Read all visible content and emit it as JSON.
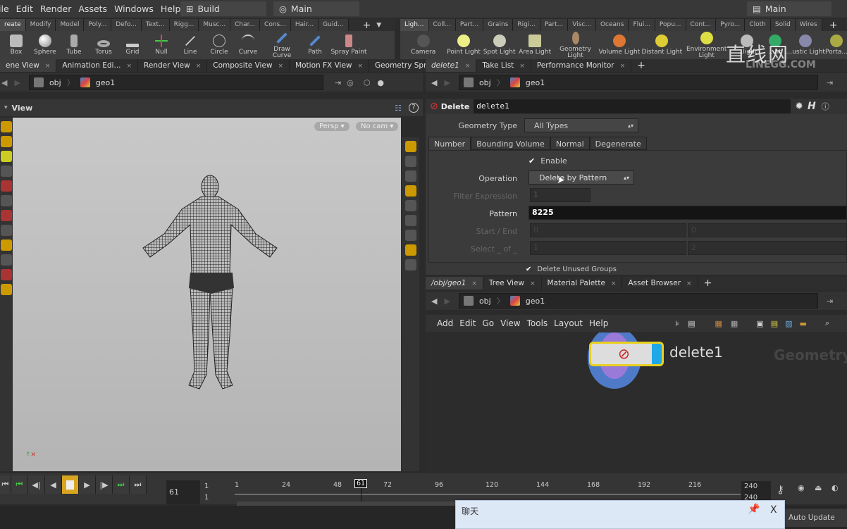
{
  "menubar": {
    "items": [
      "ile",
      "Edit",
      "Render",
      "Assets",
      "Windows",
      "Help"
    ],
    "desktop": "Build",
    "context_left": "Main",
    "context_right": "Main"
  },
  "shelf_left": {
    "tabs": [
      "reate",
      "Modify",
      "Model",
      "Poly...",
      "Defo...",
      "Text...",
      "Rigg...",
      "Musc...",
      "Char...",
      "Cons...",
      "Hair...",
      "Guid..."
    ],
    "tools": [
      "Box",
      "Sphere",
      "Tube",
      "Torus",
      "Grid",
      "Null",
      "Line",
      "Circle",
      "Curve",
      "Draw Curve",
      "Path",
      "Spray Paint"
    ]
  },
  "shelf_right": {
    "tabs": [
      "Ligh...",
      "Coll...",
      "Part...",
      "Grains",
      "Rigi...",
      "Part...",
      "Visc...",
      "Oceans",
      "Flui...",
      "Popu...",
      "Cont...",
      "Pyro...",
      "Cloth",
      "Solid",
      "Wires"
    ],
    "tools": [
      "Camera",
      "Point Light",
      "Spot Light",
      "Area Light",
      "Geometry Light",
      "Volume Light",
      "Distant Light",
      "Environment Light",
      "...light",
      "...ht",
      "...ustic Light",
      "Porta..."
    ]
  },
  "watermark": {
    "text": "直线网",
    "sub": "LINEGG.COM"
  },
  "left_pane": {
    "tabs": [
      "ene View",
      "Animation Edi...",
      "Render View",
      "Composite View",
      "Motion FX View",
      "Geometry Spr..."
    ],
    "path": [
      "obj",
      "geo1"
    ],
    "view_title": "View",
    "persp": "Persp",
    "cam": "No cam"
  },
  "params": {
    "tabs": [
      "delete1",
      "Take List",
      "Performance Monitor"
    ],
    "path": [
      "obj",
      "geo1"
    ],
    "node_type": "Delete",
    "node_name": "delete1",
    "geometry_type_label": "Geometry Type",
    "geometry_type": "All Types",
    "subtabs": [
      "Number",
      "Bounding Volume",
      "Normal",
      "Degenerate"
    ],
    "enable_label": "Enable",
    "enable": true,
    "operation_label": "Operation",
    "operation": "Delete by Pattern",
    "filter_label": "Filter Expression",
    "filter_value": "1",
    "pattern_label": "Pattern",
    "pattern": "8225",
    "startend_label": "Start / End",
    "start": "0",
    "end": "0",
    "select_label": "Select _ of _",
    "select_a": "1",
    "select_b": "2",
    "unused_groups_label": "Delete Unused Groups"
  },
  "network": {
    "tabs": [
      "/obj/geo1",
      "Tree View",
      "Material Palette",
      "Asset Browser"
    ],
    "path": [
      "obj",
      "geo1"
    ],
    "menu": [
      "Add",
      "Edit",
      "Go",
      "View",
      "Tools",
      "Layout",
      "Help"
    ],
    "node_label": "delete1",
    "context_watermark": "Geometry"
  },
  "timeline": {
    "current_frame": "61",
    "start": "1",
    "start2": "1",
    "end": "240",
    "end2": "240",
    "ticks": [
      "1",
      "24",
      "48",
      "61",
      "72",
      "96",
      "120",
      "144",
      "168",
      "192",
      "216"
    ]
  },
  "status": {
    "auto_update": "Auto Update"
  },
  "chat": {
    "title": "聊天",
    "close": "X"
  },
  "colors": {
    "accent": "#d9a520",
    "node_flag": "#1ea8e8",
    "selected_yellow": "#e8d020"
  }
}
